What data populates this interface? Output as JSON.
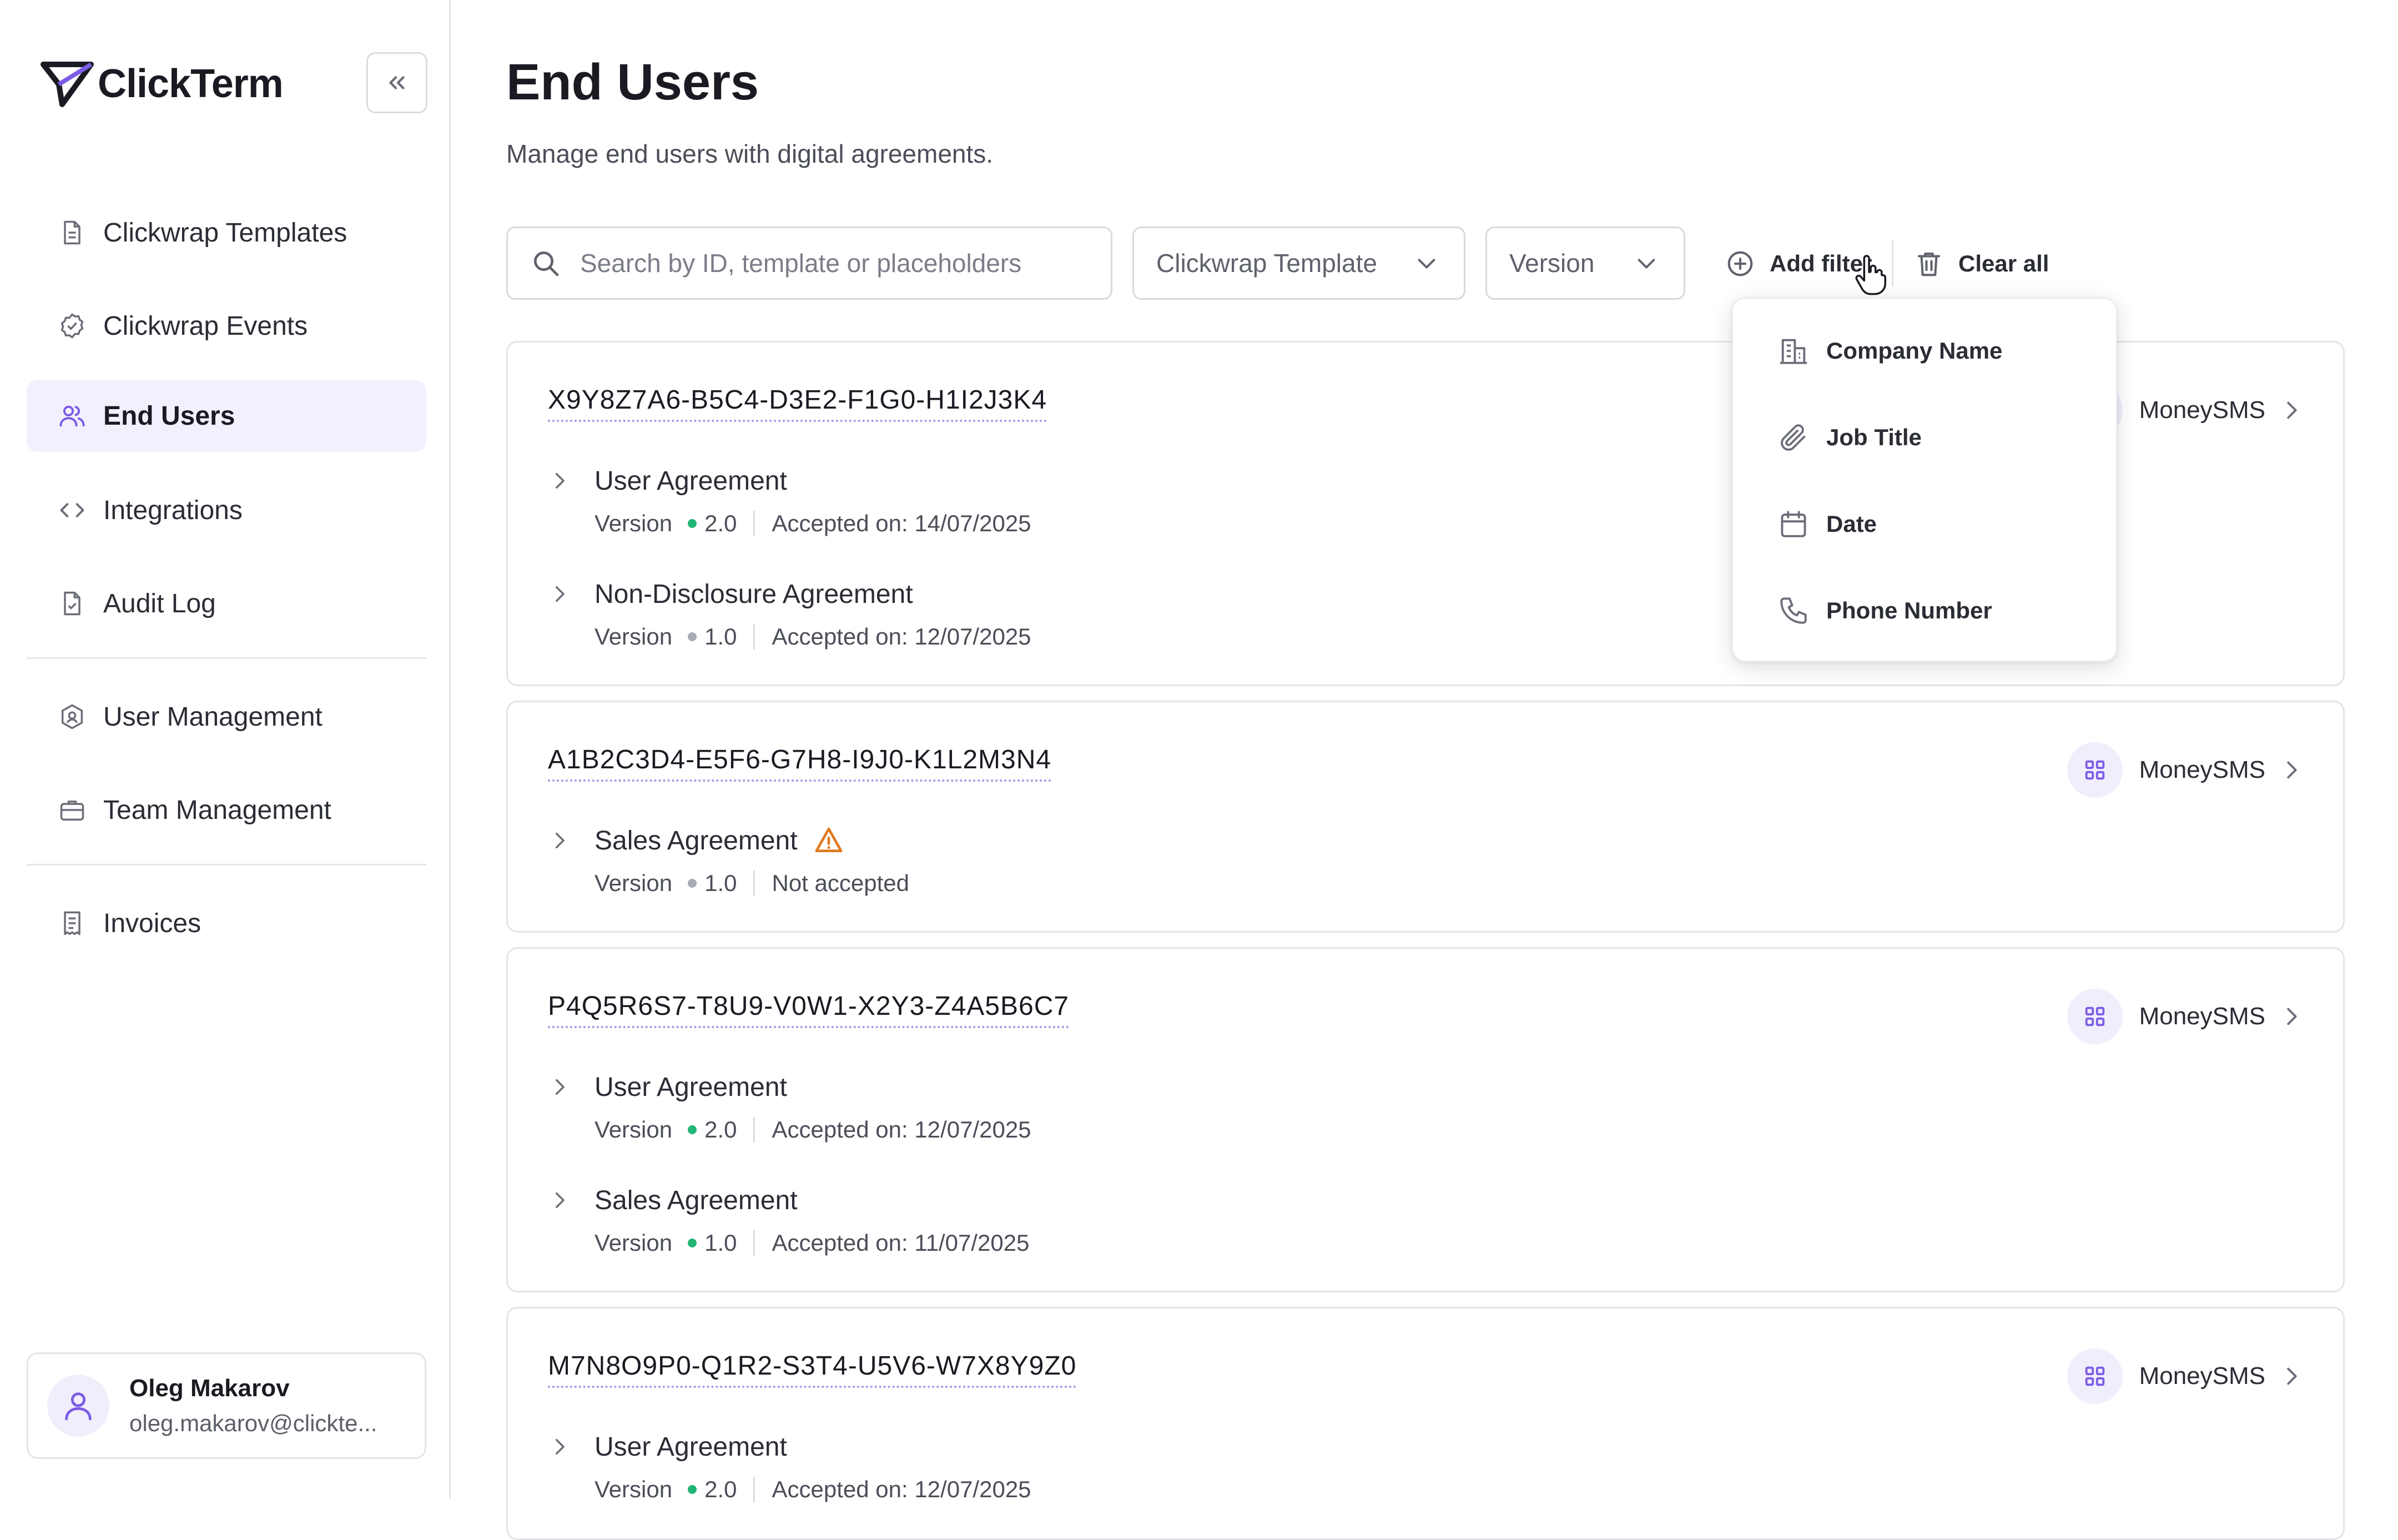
{
  "app": {
    "name": "ClickTerm"
  },
  "sidebar": {
    "collapse_label": "«",
    "items": [
      {
        "label": "Clickwrap Templates",
        "icon": "document-icon"
      },
      {
        "label": "Clickwrap Events",
        "icon": "badge-check-icon"
      },
      {
        "label": "End Users",
        "icon": "users-icon",
        "active": true
      },
      {
        "label": "Integrations",
        "icon": "code-icon"
      },
      {
        "label": "Audit Log",
        "icon": "file-check-icon"
      },
      {
        "label": "User Management",
        "icon": "shield-user-icon"
      },
      {
        "label": "Team Management",
        "icon": "briefcase-icon"
      },
      {
        "label": "Invoices",
        "icon": "receipt-icon"
      }
    ],
    "user": {
      "name": "Oleg Makarov",
      "email": "oleg.makarov@clickte..."
    }
  },
  "page": {
    "title": "End Users",
    "subtitle": "Manage end users with digital agreements."
  },
  "filters": {
    "search_placeholder": "Search by ID, template or placeholders",
    "template_select": "Clickwrap Template",
    "version_select": "Version",
    "add_filter": "Add filter",
    "clear_all": "Clear all",
    "add_filter_menu": [
      {
        "label": "Company Name",
        "icon": "building-icon"
      },
      {
        "label": "Job Title",
        "icon": "paperclip-icon"
      },
      {
        "label": "Date",
        "icon": "calendar-icon"
      },
      {
        "label": "Phone Number",
        "icon": "phone-icon"
      }
    ]
  },
  "colors": {
    "accent": "#7c5ce6",
    "active_bg": "#f3f0fd",
    "accepted": "#22b573",
    "pending": "#a8aab2",
    "warning": "#e07a1f"
  },
  "users": [
    {
      "id": "X9Y8Z7A6-B5C4-D3E2-F1G0-H1I2J3K4",
      "org": "MoneySMS",
      "agreements": [
        {
          "name": "User Agreement",
          "version_label": "Version",
          "version": "2.0",
          "status": "Accepted on: 14/07/2025",
          "dot": "green"
        },
        {
          "name": "Non-Disclosure Agreement",
          "version_label": "Version",
          "version": "1.0",
          "status": "Accepted on: 12/07/2025",
          "dot": "gray"
        }
      ]
    },
    {
      "id": "A1B2C3D4-E5F6-G7H8-I9J0-K1L2M3N4",
      "org": "MoneySMS",
      "agreements": [
        {
          "name": "Sales Agreement",
          "version_label": "Version",
          "version": "1.0",
          "status": "Not accepted",
          "dot": "gray",
          "warning": true
        }
      ]
    },
    {
      "id": "P4Q5R6S7-T8U9-V0W1-X2Y3-Z4A5B6C7",
      "org": "MoneySMS",
      "agreements": [
        {
          "name": "User Agreement",
          "version_label": "Version",
          "version": "2.0",
          "status": "Accepted on: 12/07/2025",
          "dot": "green"
        },
        {
          "name": "Sales Agreement",
          "version_label": "Version",
          "version": "1.0",
          "status": "Accepted on: 11/07/2025",
          "dot": "green"
        }
      ]
    },
    {
      "id": "M7N8O9P0-Q1R2-S3T4-U5V6-W7X8Y9Z0",
      "org": "MoneySMS",
      "agreements": [
        {
          "name": "User Agreement",
          "version_label": "Version",
          "version": "2.0",
          "status": "Accepted on: 12/07/2025",
          "dot": "green"
        }
      ]
    }
  ]
}
